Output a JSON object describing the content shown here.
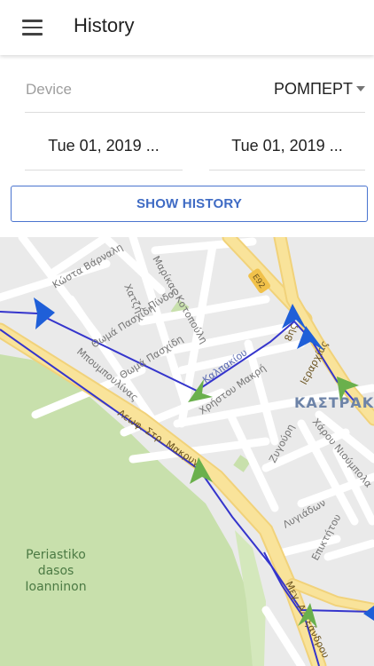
{
  "header": {
    "menu_icon": "menu-icon",
    "title": "History"
  },
  "device": {
    "label": "Device",
    "selected": "ΡΟΜΠΕΡΤ",
    "dropdown_icon": "dropdown-arrow-icon"
  },
  "dates": {
    "from": "Tue 01, 2019 ...",
    "to": "Tue 01, 2019 ..."
  },
  "actions": {
    "show_history": "SHOW HISTORY"
  },
  "map": {
    "district": "ΚΑΣΤΡΑΚΗ",
    "park": [
      "Periastiko",
      "dasos",
      "Ioanninon"
    ],
    "road_badge": "E92",
    "streets": {
      "kosta_varnali": "Κώστα Βάρναλη",
      "chatzi": "Χατζή",
      "pindou": "Πίνδου",
      "marikas_kotopouli": "Μαρίκας Κοτοπούλη",
      "thoma_paschidi_1": "Θωμά Πασχίδη",
      "thoma_paschidi_2": "Θωμά Πασχίδη",
      "boumpoulinas": "Μπουμπουλίνας",
      "kalpakiou": "Καλπακίου",
      "christou_maki": "Χρήστου Μακρή",
      "leof_str_makrygianni": "Λεωφ. Στρ. Μακρυγ",
      "ierarchias": "Ιεραρχίας",
      "charou_nioumpola": "Χάρου Νιούμπολα",
      "zygouri": "Ζυγούρη",
      "lygiadon": "Λυγιάδων",
      "epiktitou": "Επικτήτου",
      "megalou_alexandrou": "Μεγ. Αλεξάνδρου",
      "vth": "8ης"
    },
    "colors": {
      "route": "#3535cc",
      "marker_blue": "#1f5fd8",
      "marker_green": "#6ab04c",
      "park": "#c8e0ac",
      "main_road": "#f9e39a",
      "district_label": "#6e84a8"
    }
  }
}
